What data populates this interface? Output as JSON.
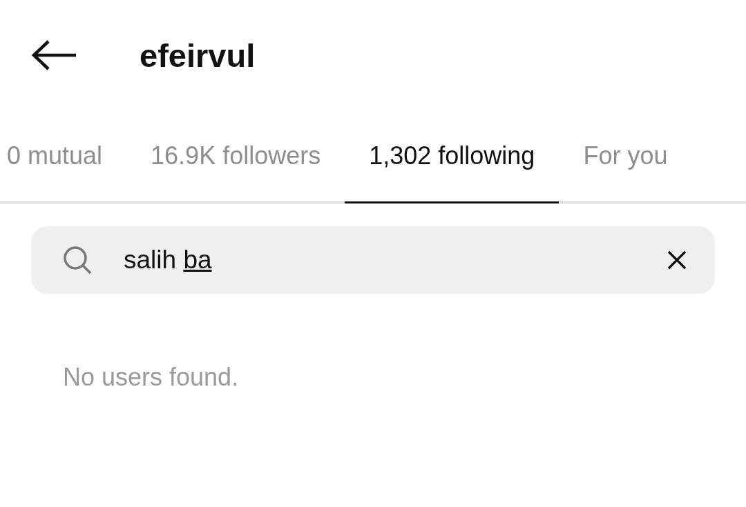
{
  "header": {
    "title": "efeirvul"
  },
  "tabs": [
    {
      "label": "0 mutual",
      "selected": false
    },
    {
      "label": "16.9K followers",
      "selected": false
    },
    {
      "label": "1,302 following",
      "selected": true
    },
    {
      "label": "For you",
      "selected": false
    }
  ],
  "search": {
    "value": "salih ba",
    "composing_last_word": true
  },
  "empty_message": "No users found."
}
